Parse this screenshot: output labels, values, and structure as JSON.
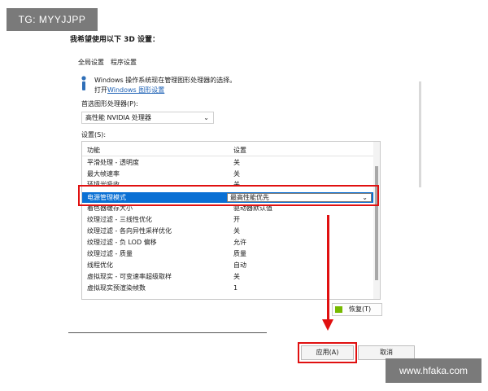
{
  "watermarks": {
    "top_left": "TG: MYYJJPP",
    "bottom_right": "www.hfaka.com"
  },
  "heading": "我希望使用以下 3D 设置：",
  "tabs": [
    {
      "label": "全局设置",
      "selected": true
    },
    {
      "label": "程序设置",
      "selected": false
    }
  ],
  "info": {
    "icon": "info-icon",
    "line1": "Windows 操作系统现在管理图形处理器的选择。",
    "line2_prefix": "打开",
    "line2_link": "Windows 图形设置"
  },
  "preferred_gpu": {
    "label": "首选图形处理器(P):",
    "value": "高性能 NVIDIA 处理器"
  },
  "settings": {
    "label": "设置(S):",
    "columns": {
      "feature": "功能",
      "setting": "设置"
    },
    "rows": [
      {
        "feature": "平滑处理 - 透明度",
        "setting": "关"
      },
      {
        "feature": "最大帧速率",
        "setting": "关"
      },
      {
        "feature": "环境光吸收",
        "setting": "关"
      },
      {
        "feature": "电源管理模式",
        "setting": "最高性能优先",
        "selected": true
      },
      {
        "feature": "着色器缓存大小",
        "setting": "驱动器默认值"
      },
      {
        "feature": "纹理过滤 - 三线性优化",
        "setting": "开"
      },
      {
        "feature": "纹理过滤 - 各向异性采样优化",
        "setting": "关"
      },
      {
        "feature": "纹理过滤 - 负 LOD 偏移",
        "setting": "允许"
      },
      {
        "feature": "纹理过滤 - 质量",
        "setting": "质量"
      },
      {
        "feature": "线程优化",
        "setting": "自动"
      },
      {
        "feature": "虚拟现实 - 可变速率超级取样",
        "setting": "关"
      },
      {
        "feature": "虚拟现实预渲染帧数",
        "setting": "1"
      }
    ]
  },
  "buttons": {
    "restore": "恢复(T)",
    "apply": "应用(A)",
    "cancel": "取消"
  },
  "colors": {
    "annotation_red": "#e01010",
    "selection_blue": "#0a70d4",
    "nvidia_green": "#76b900",
    "link_blue": "#1a5fb4"
  }
}
